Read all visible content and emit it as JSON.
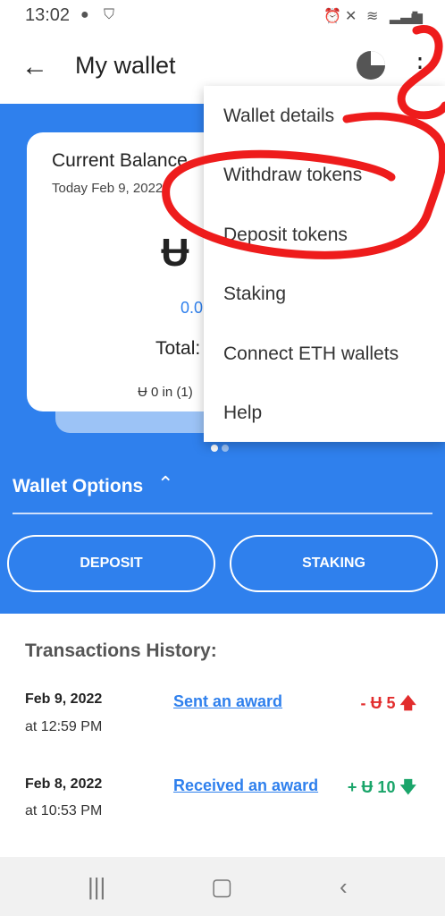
{
  "status": {
    "time": "13:02"
  },
  "header": {
    "title": "My wallet"
  },
  "balance_card": {
    "label": "Current Balance",
    "date": "Today Feb 9, 2022",
    "coin_symbol": "Ʉ",
    "value": "0.0",
    "total_label": "Total:",
    "in_text": "Ʉ 0 in (1)"
  },
  "wallet_options": {
    "title": "Wallet Options",
    "deposit_label": "DEPOSIT",
    "staking_label": "STAKING"
  },
  "transactions": {
    "title": "Transactions History:",
    "items": [
      {
        "date": "Feb 9, 2022",
        "time": "at 12:59 PM",
        "description": "Sent an award",
        "amount": "- Ʉ 5",
        "direction": "up"
      },
      {
        "date": "Feb 8, 2022",
        "time": "at 10:53 PM",
        "description": "Received an award",
        "amount": "+ Ʉ 10",
        "direction": "down"
      }
    ]
  },
  "menu": {
    "items": [
      "Wallet details",
      "Withdraw tokens",
      "Deposit tokens",
      "Staking",
      "Connect ETH wallets",
      "Help"
    ]
  },
  "colors": {
    "accent": "#2f80ed",
    "negative": "#e22d2d",
    "positive": "#1aa56a",
    "annotation": "#ee1c1c"
  }
}
